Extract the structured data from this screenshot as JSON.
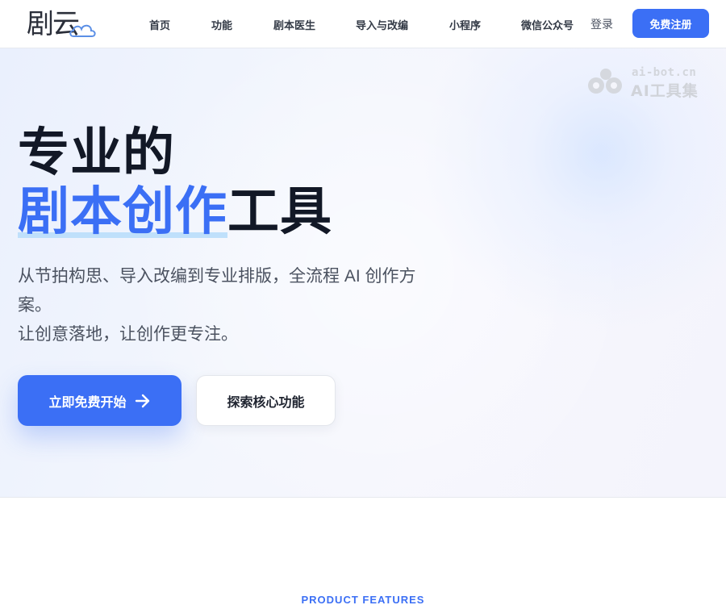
{
  "header": {
    "logo_text": "剧云",
    "nav": [
      {
        "label": "首页"
      },
      {
        "label": "功能"
      },
      {
        "label": "剧本医生"
      },
      {
        "label": "导入与改编"
      },
      {
        "label": "小程序"
      },
      {
        "label": "微信公众号"
      }
    ],
    "login_label": "登录",
    "signup_label": "免费注册"
  },
  "watermark": {
    "top": "ai-bot.cn",
    "bottom": "AI工具集"
  },
  "hero": {
    "title_line1": "专业的",
    "title_accent": "剧本创作",
    "title_rest": "工具",
    "subtitle_line1": "从节拍构思、导入改编到专业排版，全流程 AI 创作方案。",
    "subtitle_line2": "让创意落地，让创作更专注。",
    "cta_primary_label": "立即免费开始",
    "cta_primary_icon": "arrow-right-icon",
    "cta_secondary_label": "探索核心功能"
  },
  "features_section": {
    "label": "PRODUCT FEATURES"
  },
  "colors": {
    "accent": "#3b6ff5",
    "title": "#121826",
    "accent_underline": "#bfe0fb"
  }
}
